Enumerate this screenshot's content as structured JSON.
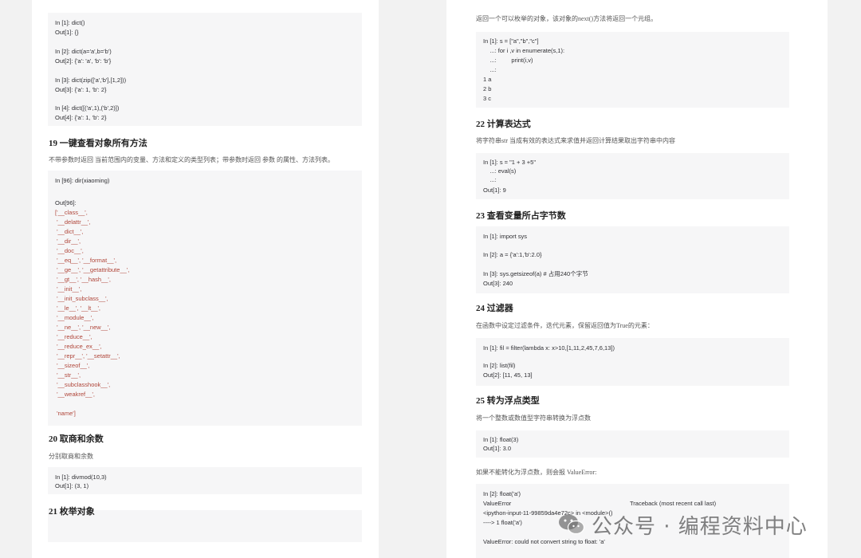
{
  "left_page": {
    "block1": {
      "lines": [
        "In [1]: dict()",
        "Out[1]: {}",
        "In [2]: dict(a='a',b='b')",
        "Out[2]: {'a': 'a', 'b': 'b'}",
        "In [3]: dict(zip(['a','b'],[1,2]))",
        "Out[3]: {'a': 1, 'b': 2}",
        "In [4]: dict([('a',1),('b',2)])",
        "Out[4]: {'a': 1, 'b': 2}"
      ]
    },
    "s19": {
      "title": "19 一键查看对象所有方法",
      "desc": "不带参数时返回 当前范围内的变量、方法和定义的类型列表；带参数时返回 参数 的属性、方法列表。"
    },
    "block2": {
      "lines": [
        "In [96]: dir(xiaoming)",
        "Out[96]:",
        "['__class__',",
        " '__delattr__',",
        " '__dict__',",
        " '__dir__',",
        " '__doc__',",
        " '__eq__', '__format__',",
        " '__ge__', '__getattribute__',",
        " '__gt__', '__hash__',",
        " '__init__',",
        " '__init_subclass__',",
        " '__le__', '__lt__',",
        " '__module__',",
        " '__ne__', '__new__',",
        " '__reduce__',",
        " '__reduce_ex__',",
        " '__repr__', '__setattr__',",
        " '__sizeof__',",
        " '__str__',",
        " '__subclasshook__',",
        " '__weakref__',",
        " 'name']"
      ]
    },
    "s20": {
      "title": "20 取商和余数",
      "desc": "分别取商和余数"
    },
    "block3": {
      "lines": [
        "In [1]: divmod(10,3)",
        "Out[1]: (3, 1)"
      ]
    },
    "s21": {
      "title": "21 枚举对象"
    }
  },
  "right_page": {
    "intro": "返回一个可以枚举的对象，该对象的next()方法将返回一个元组。",
    "block1": {
      "lines": [
        "In [1]: s = [\"a\",\"b\",\"c\"]",
        "    ...: for i ,v in enumerate(s,1):",
        "    ...:         print(i,v)",
        "    ...:",
        "1 a",
        "2 b",
        "3 c"
      ]
    },
    "s22": {
      "title": "22 计算表达式",
      "desc": "将字符串str 当成有效的表达式来求值并返回计算结果取出字符串中内容"
    },
    "block2": {
      "lines": [
        "In [1]: s = \"1 + 3 +5\"",
        "    ...: eval(s)",
        "    ...:",
        "Out[1]: 9"
      ]
    },
    "s23": {
      "title": "23 查看变量所占字节数"
    },
    "block3": {
      "lines": [
        "In [1]: import sys",
        "In [2]: a = {'a':1,'b':2.0}",
        "In [3]: sys.getsizeof(a) # 占用240个字节",
        "Out[3]: 240"
      ]
    },
    "s24": {
      "title": "24 过滤器",
      "desc": "在函数中设定过滤条件，迭代元素，保留返回值为True的元素："
    },
    "block4": {
      "lines": [
        "In [1]: fil = filter(lambda x: x>10,[1,11,2,45,7,6,13])",
        "In [2]: list(fil)",
        "Out[2]: [11, 45, 13]"
      ]
    },
    "s25": {
      "title": "25 转为浮点类型",
      "desc": "将一个整数或数值型字符串转换为浮点数",
      "note": "如果不能转化为浮点数，则会报 ValueError:"
    },
    "block5": {
      "lines": [
        "In [1]: float(3)",
        "Out[1]: 3.0"
      ]
    },
    "block6": {
      "lines": [
        "In [2]: float('a')",
        "ValueError",
        "Traceback (most recent call last)",
        "<ipython-input-11-99859da4e72c> in <module>()",
        "----> 1 float('a')",
        "ValueError: could not convert string to float: 'a'"
      ]
    }
  },
  "watermark": {
    "text": "公众号 · 编程资料中心",
    "icon": "wechat-icon"
  }
}
